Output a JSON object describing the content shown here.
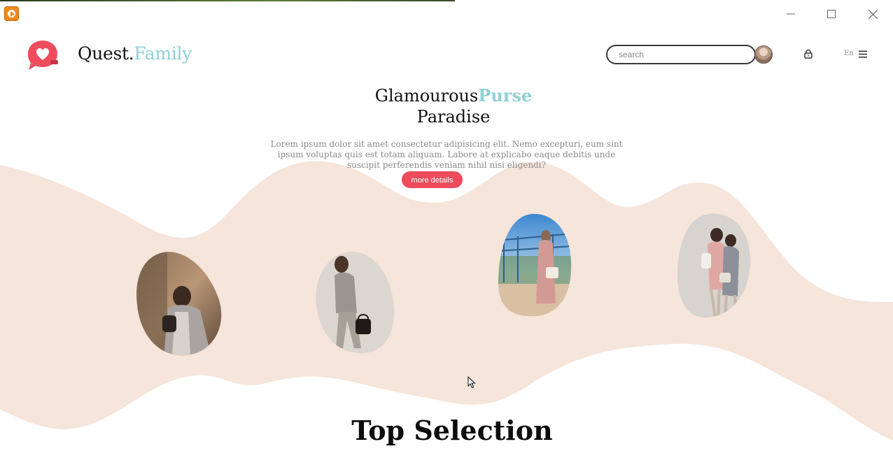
{
  "window": {
    "controls": [
      "minimize-icon",
      "maximize-icon",
      "close-icon"
    ],
    "app_icon": "media-player-icon"
  },
  "header": {
    "brand_prefix": "Quest.",
    "brand_accent": "Family",
    "logo_icon": "heart-chat-bubble-icon",
    "search_placeholder": "search",
    "lock_icon": "lock-icon",
    "language": "En",
    "menu_icon": "hamburger-menu-icon"
  },
  "hero": {
    "title_part1": "Glamourous",
    "title_accent": "Purse",
    "title_line2": "Paradise",
    "description": "Lorem ipsum dolor sit amet consectetur adipisicing elit. Nemo excepturi, eum sint ipsum voluptas quis est totam aliquam. Labore at explicabo eaque debitis unde suscipit perferendis veniam nihil nisi eligendi?",
    "button_label": "more details"
  },
  "gallery": {
    "photos": [
      "woman-with-purse-photo-1",
      "woman-with-purse-photo-2",
      "woman-with-purse-photo-3",
      "two-women-with-purse-photo"
    ]
  },
  "sections": {
    "top_selection_title": "Top Selection"
  },
  "colors": {
    "accent_teal": "#8fd0d6",
    "button_red": "#ee4b5c",
    "wave_peach": "#f6e5da",
    "logo_red": "#ef4d5e"
  }
}
